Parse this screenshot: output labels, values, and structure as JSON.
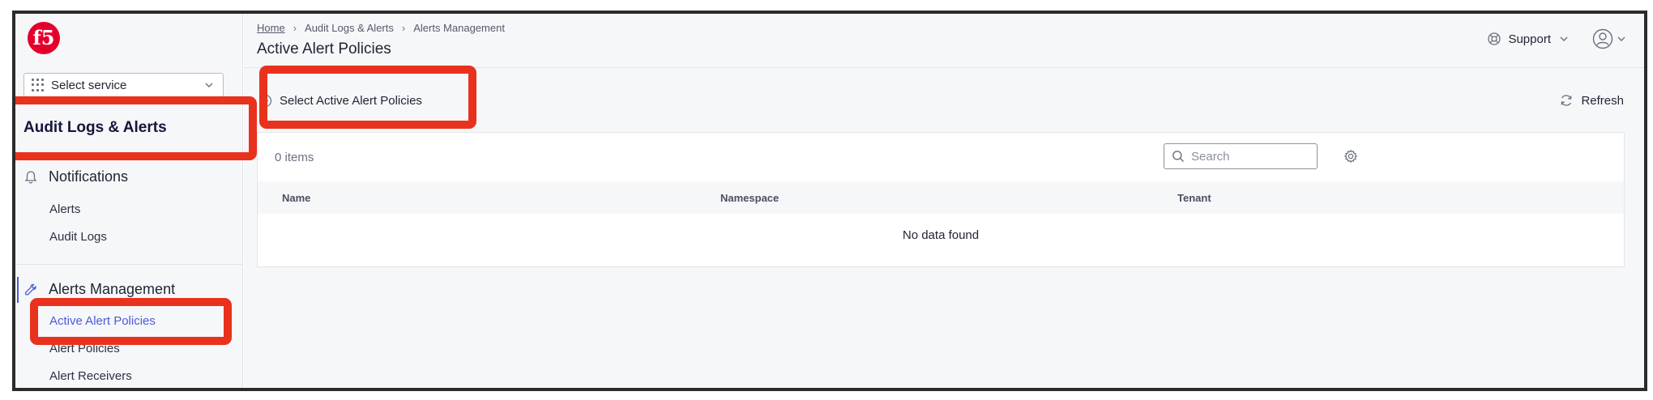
{
  "sidebar": {
    "service_select": {
      "label": "Select service"
    },
    "section_title": "Audit Logs & Alerts",
    "groups": [
      {
        "label": "Notifications",
        "icon": "bell-icon",
        "items": [
          {
            "label": "Alerts"
          },
          {
            "label": "Audit Logs"
          }
        ]
      },
      {
        "label": "Alerts Management",
        "icon": "wrench-icon",
        "items": [
          {
            "label": "Active Alert Policies",
            "active": true
          },
          {
            "label": "Alert Policies"
          },
          {
            "label": "Alert Receivers"
          }
        ]
      }
    ]
  },
  "header": {
    "breadcrumb": [
      "Home",
      "Audit Logs & Alerts",
      "Alerts Management"
    ],
    "title": "Active Alert Policies",
    "support_label": "Support"
  },
  "actions": {
    "select_label": "Select Active Alert Policies",
    "refresh_label": "Refresh"
  },
  "table": {
    "count_label": "0 items",
    "search_placeholder": "Search",
    "columns": [
      "Name",
      "Namespace",
      "Tenant"
    ],
    "empty_message": "No data found"
  },
  "colors": {
    "accent": "#4a5bd9",
    "highlight": "#e8321e",
    "brand": "#e4002b"
  }
}
